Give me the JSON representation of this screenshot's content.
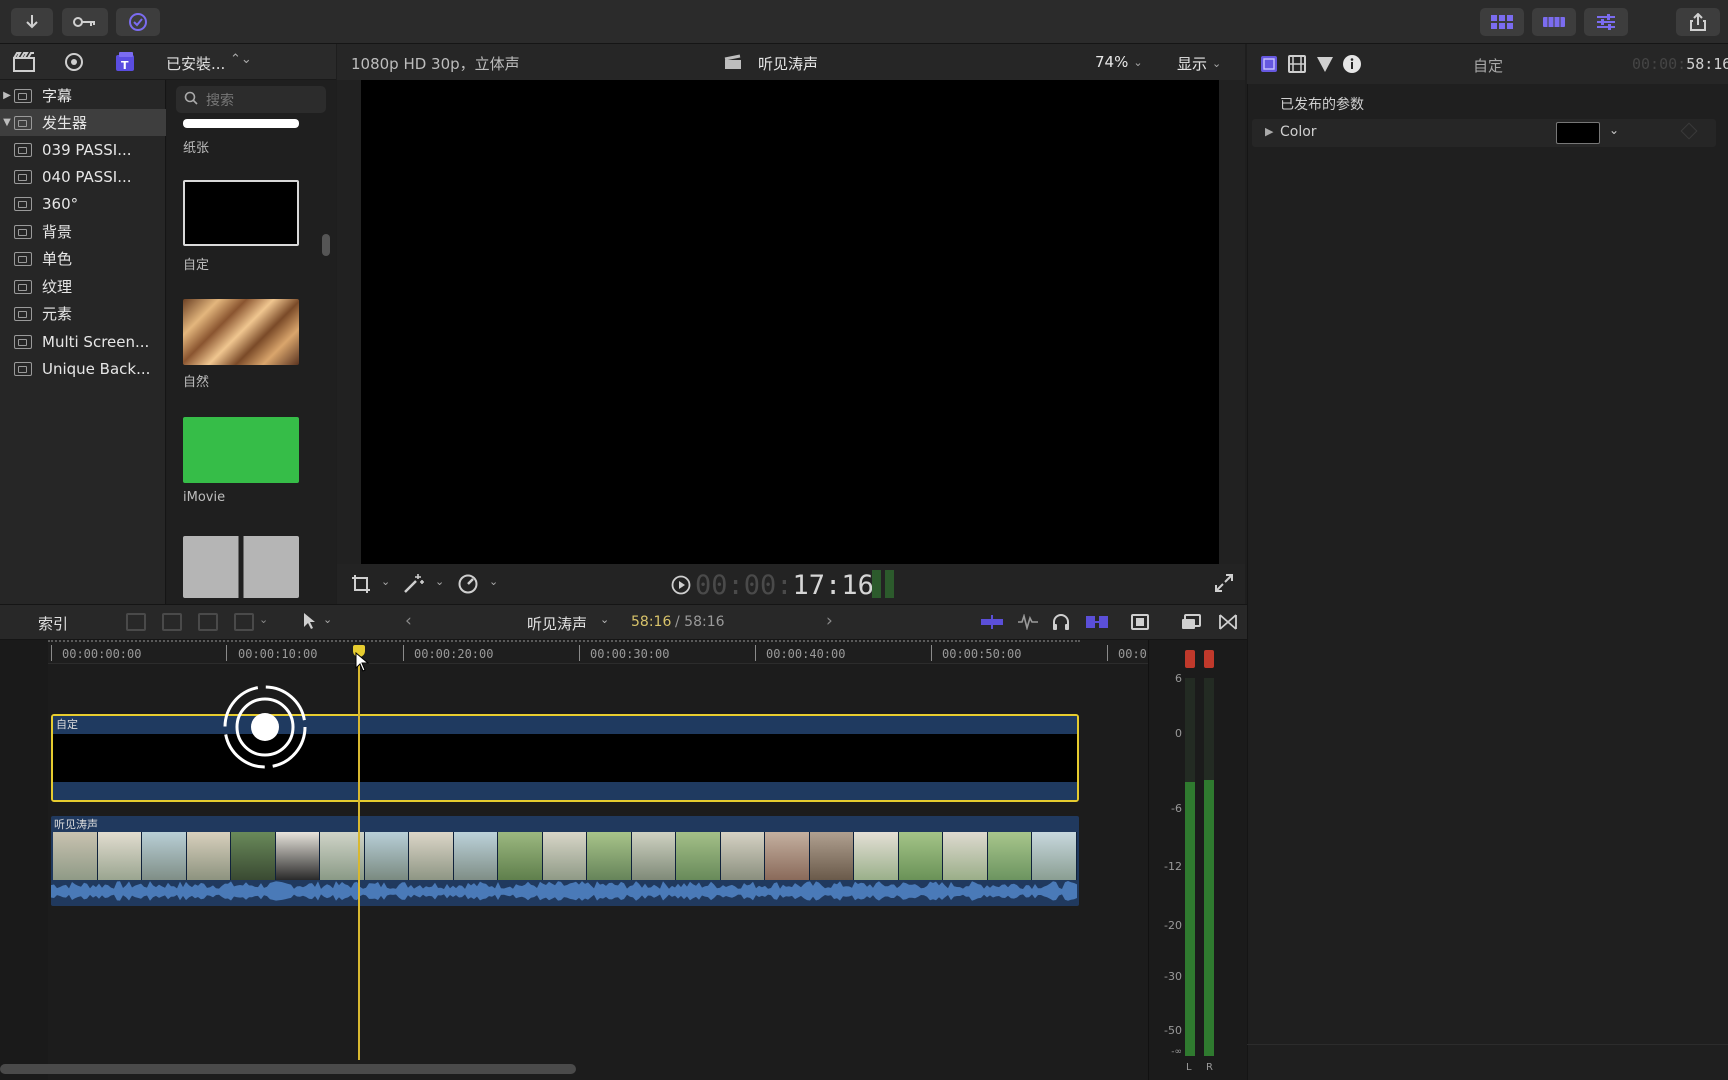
{
  "toolbar": {
    "import_icon": "down-arrow-icon",
    "keyword_icon": "key-icon",
    "background_tasks_icon": "checkmark-circle-icon",
    "share_icon": "share-icon"
  },
  "browser": {
    "installed_label": "已安裝...",
    "search_placeholder": "搜索",
    "items": [
      {
        "label": "字幕",
        "expander": "▶"
      },
      {
        "label": "发生器",
        "expander": "▼"
      },
      {
        "label": "039 PASSI..."
      },
      {
        "label": "040 PASSI..."
      },
      {
        "label": "360°"
      },
      {
        "label": "背景"
      },
      {
        "label": "单色"
      },
      {
        "label": "纹理"
      },
      {
        "label": "元素"
      },
      {
        "label": "Multi Screen..."
      },
      {
        "label": "Unique Back..."
      }
    ],
    "thumbnails": [
      {
        "label": "纸张",
        "color": "#ffffff"
      },
      {
        "label": "自定",
        "color": "#000000"
      },
      {
        "label": "自然",
        "color": "#b07a45"
      },
      {
        "label": "iMovie",
        "color": "#36bd48"
      }
    ]
  },
  "viewer": {
    "format": "1080p HD 30p，立体声",
    "project": "听见涛声",
    "zoom": "74%",
    "display_label": "显示",
    "timecode_dim": "00:00:",
    "timecode": "17:16"
  },
  "inspector": {
    "title": "自定",
    "duration_dim": "00:00:",
    "duration": "58:16",
    "section_label": "已发布的参数",
    "param_expander": "▶",
    "param_label": "Color",
    "swatch_color": "#000000"
  },
  "timeline": {
    "index_label": "索引",
    "project": "听见涛声",
    "timecode_current": "58:16",
    "timecode_total": "/ 58:16",
    "ruler": [
      "00:00:00:00",
      "00:00:10:00",
      "00:00:20:00",
      "00:00:30:00",
      "00:00:40:00",
      "00:00:50:00",
      "00:0"
    ],
    "clip_top": "自定",
    "clip_bottom": "听见涛声",
    "meter_scale": [
      "6",
      "0",
      "-6",
      "-12",
      "-20",
      "-30",
      "-50",
      "-∞"
    ],
    "meter_channels": [
      "L",
      "R"
    ]
  }
}
